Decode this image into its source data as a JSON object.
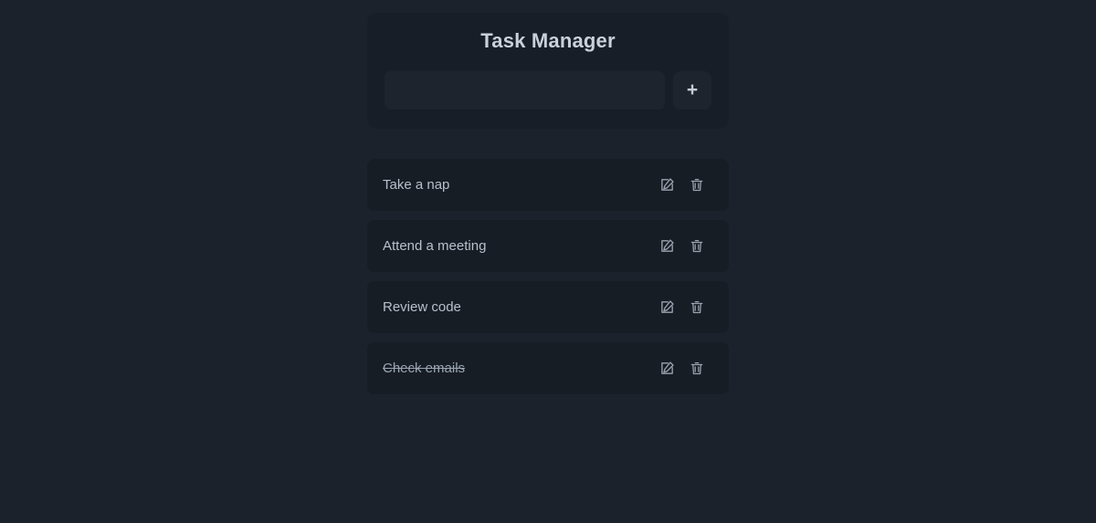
{
  "header": {
    "title": "Task Manager",
    "input": {
      "value": "",
      "placeholder": ""
    },
    "add_button_label": "+"
  },
  "tasks": [
    {
      "label": "Take a nap",
      "completed": false,
      "edit_icon": "edit-icon",
      "delete_icon": "trash-icon"
    },
    {
      "label": "Attend a meeting",
      "completed": false,
      "edit_icon": "edit-icon",
      "delete_icon": "trash-icon"
    },
    {
      "label": "Review code",
      "completed": false,
      "edit_icon": "edit-icon",
      "delete_icon": "trash-icon"
    },
    {
      "label": "Check emails",
      "completed": true,
      "edit_icon": "edit-icon",
      "delete_icon": "trash-icon"
    }
  ],
  "colors": {
    "page_background": "#1b222c",
    "panel_background": "#181e27",
    "row_background": "#171d25",
    "input_background": "#1e242e",
    "title_text": "#c8d1da",
    "task_text": "#b6c0cb",
    "icon": "#9aa4b0"
  }
}
